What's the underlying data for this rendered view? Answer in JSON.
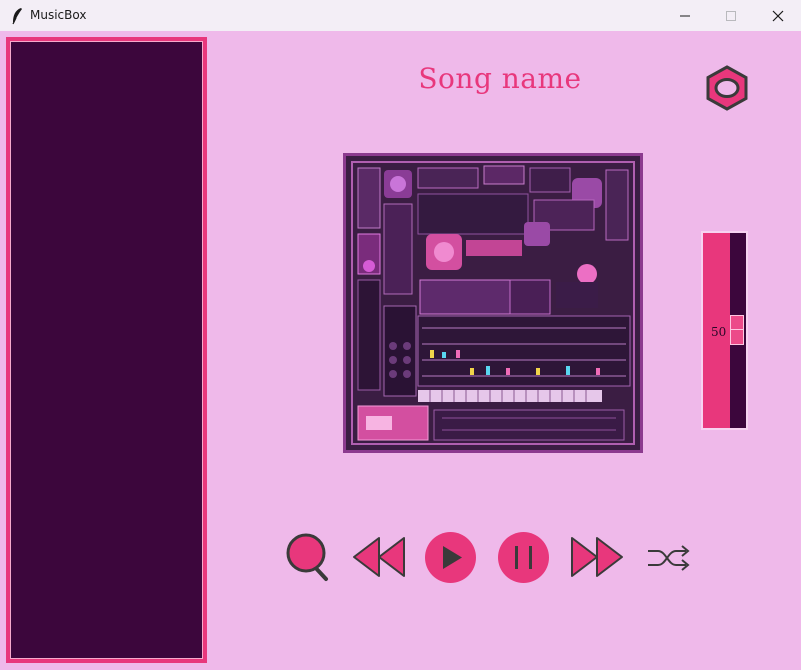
{
  "window": {
    "title": "MusicBox",
    "icon": "feather-icon",
    "controls": [
      "minimize-icon",
      "maximize-icon",
      "close-icon"
    ]
  },
  "colors": {
    "background": "#efb9ea",
    "accent": "#e8377c",
    "panel_dark": "#3c063c"
  },
  "player": {
    "song_name": "Song name",
    "settings_icon": "hexagon-nut-icon",
    "volume": {
      "value": "50"
    },
    "controls": {
      "search": "search-icon",
      "previous": "rewind-icon",
      "play": "play-icon",
      "pause": "pause-icon",
      "next": "fast-forward-icon",
      "shuffle": "shuffle-icon"
    }
  }
}
